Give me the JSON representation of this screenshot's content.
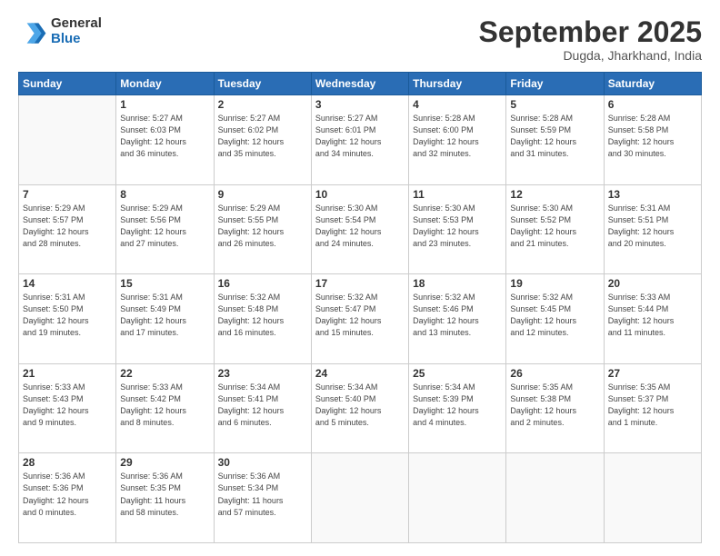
{
  "header": {
    "logo_general": "General",
    "logo_blue": "Blue",
    "month_title": "September 2025",
    "location": "Dugda, Jharkhand, India"
  },
  "weekdays": [
    "Sunday",
    "Monday",
    "Tuesday",
    "Wednesday",
    "Thursday",
    "Friday",
    "Saturday"
  ],
  "weeks": [
    [
      {
        "day": "",
        "info": ""
      },
      {
        "day": "1",
        "info": "Sunrise: 5:27 AM\nSunset: 6:03 PM\nDaylight: 12 hours\nand 36 minutes."
      },
      {
        "day": "2",
        "info": "Sunrise: 5:27 AM\nSunset: 6:02 PM\nDaylight: 12 hours\nand 35 minutes."
      },
      {
        "day": "3",
        "info": "Sunrise: 5:27 AM\nSunset: 6:01 PM\nDaylight: 12 hours\nand 34 minutes."
      },
      {
        "day": "4",
        "info": "Sunrise: 5:28 AM\nSunset: 6:00 PM\nDaylight: 12 hours\nand 32 minutes."
      },
      {
        "day": "5",
        "info": "Sunrise: 5:28 AM\nSunset: 5:59 PM\nDaylight: 12 hours\nand 31 minutes."
      },
      {
        "day": "6",
        "info": "Sunrise: 5:28 AM\nSunset: 5:58 PM\nDaylight: 12 hours\nand 30 minutes."
      }
    ],
    [
      {
        "day": "7",
        "info": "Sunrise: 5:29 AM\nSunset: 5:57 PM\nDaylight: 12 hours\nand 28 minutes."
      },
      {
        "day": "8",
        "info": "Sunrise: 5:29 AM\nSunset: 5:56 PM\nDaylight: 12 hours\nand 27 minutes."
      },
      {
        "day": "9",
        "info": "Sunrise: 5:29 AM\nSunset: 5:55 PM\nDaylight: 12 hours\nand 26 minutes."
      },
      {
        "day": "10",
        "info": "Sunrise: 5:30 AM\nSunset: 5:54 PM\nDaylight: 12 hours\nand 24 minutes."
      },
      {
        "day": "11",
        "info": "Sunrise: 5:30 AM\nSunset: 5:53 PM\nDaylight: 12 hours\nand 23 minutes."
      },
      {
        "day": "12",
        "info": "Sunrise: 5:30 AM\nSunset: 5:52 PM\nDaylight: 12 hours\nand 21 minutes."
      },
      {
        "day": "13",
        "info": "Sunrise: 5:31 AM\nSunset: 5:51 PM\nDaylight: 12 hours\nand 20 minutes."
      }
    ],
    [
      {
        "day": "14",
        "info": "Sunrise: 5:31 AM\nSunset: 5:50 PM\nDaylight: 12 hours\nand 19 minutes."
      },
      {
        "day": "15",
        "info": "Sunrise: 5:31 AM\nSunset: 5:49 PM\nDaylight: 12 hours\nand 17 minutes."
      },
      {
        "day": "16",
        "info": "Sunrise: 5:32 AM\nSunset: 5:48 PM\nDaylight: 12 hours\nand 16 minutes."
      },
      {
        "day": "17",
        "info": "Sunrise: 5:32 AM\nSunset: 5:47 PM\nDaylight: 12 hours\nand 15 minutes."
      },
      {
        "day": "18",
        "info": "Sunrise: 5:32 AM\nSunset: 5:46 PM\nDaylight: 12 hours\nand 13 minutes."
      },
      {
        "day": "19",
        "info": "Sunrise: 5:32 AM\nSunset: 5:45 PM\nDaylight: 12 hours\nand 12 minutes."
      },
      {
        "day": "20",
        "info": "Sunrise: 5:33 AM\nSunset: 5:44 PM\nDaylight: 12 hours\nand 11 minutes."
      }
    ],
    [
      {
        "day": "21",
        "info": "Sunrise: 5:33 AM\nSunset: 5:43 PM\nDaylight: 12 hours\nand 9 minutes."
      },
      {
        "day": "22",
        "info": "Sunrise: 5:33 AM\nSunset: 5:42 PM\nDaylight: 12 hours\nand 8 minutes."
      },
      {
        "day": "23",
        "info": "Sunrise: 5:34 AM\nSunset: 5:41 PM\nDaylight: 12 hours\nand 6 minutes."
      },
      {
        "day": "24",
        "info": "Sunrise: 5:34 AM\nSunset: 5:40 PM\nDaylight: 12 hours\nand 5 minutes."
      },
      {
        "day": "25",
        "info": "Sunrise: 5:34 AM\nSunset: 5:39 PM\nDaylight: 12 hours\nand 4 minutes."
      },
      {
        "day": "26",
        "info": "Sunrise: 5:35 AM\nSunset: 5:38 PM\nDaylight: 12 hours\nand 2 minutes."
      },
      {
        "day": "27",
        "info": "Sunrise: 5:35 AM\nSunset: 5:37 PM\nDaylight: 12 hours\nand 1 minute."
      }
    ],
    [
      {
        "day": "28",
        "info": "Sunrise: 5:36 AM\nSunset: 5:36 PM\nDaylight: 12 hours\nand 0 minutes."
      },
      {
        "day": "29",
        "info": "Sunrise: 5:36 AM\nSunset: 5:35 PM\nDaylight: 11 hours\nand 58 minutes."
      },
      {
        "day": "30",
        "info": "Sunrise: 5:36 AM\nSunset: 5:34 PM\nDaylight: 11 hours\nand 57 minutes."
      },
      {
        "day": "",
        "info": ""
      },
      {
        "day": "",
        "info": ""
      },
      {
        "day": "",
        "info": ""
      },
      {
        "day": "",
        "info": ""
      }
    ]
  ]
}
